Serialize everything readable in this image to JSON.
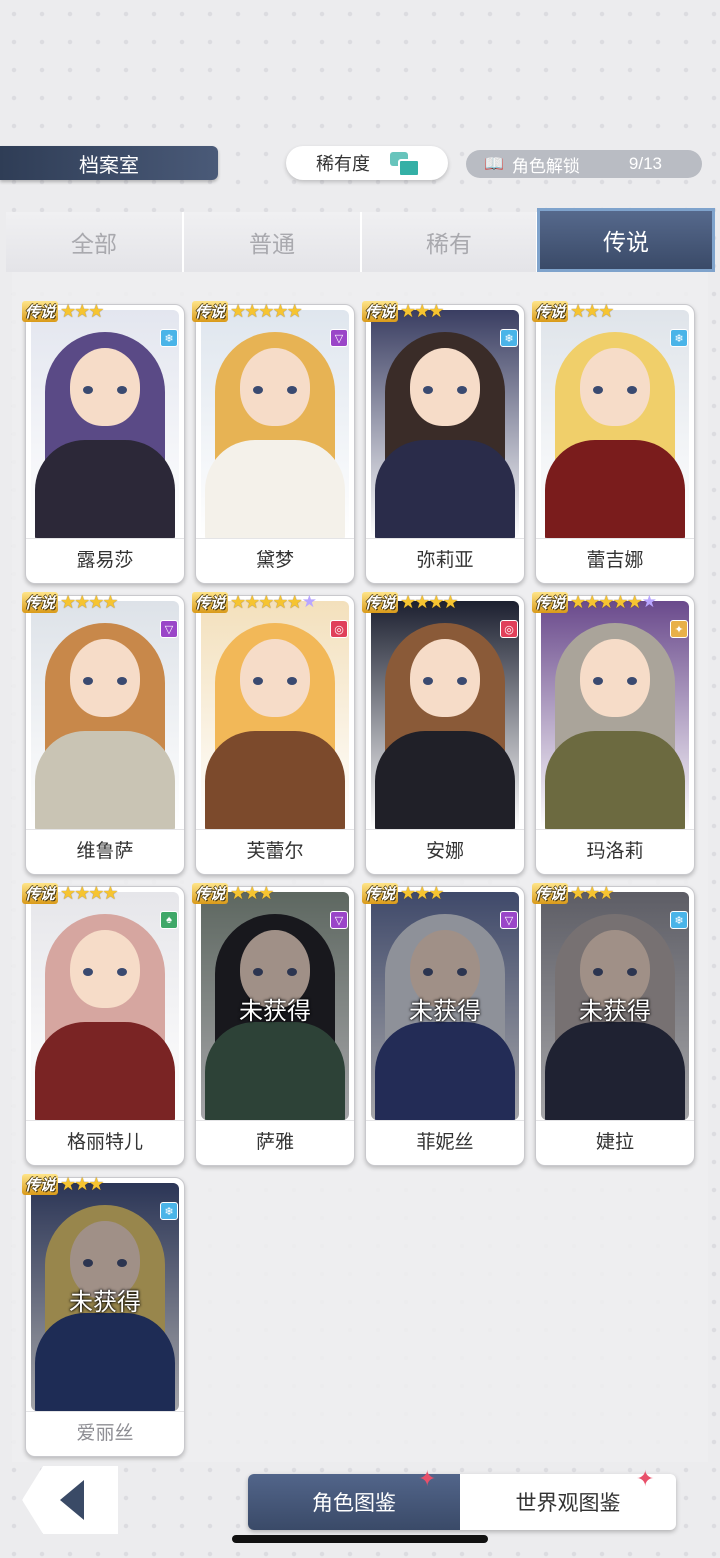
{
  "header": {
    "title": "档案室"
  },
  "rarity_button": {
    "label": "稀有度",
    "icon": "layers-icon",
    "accent": "#34b0a6"
  },
  "unlock": {
    "icon": "book-icon",
    "label": "角色解锁",
    "count": "9/13"
  },
  "tabs": [
    {
      "label": "全部",
      "active": false
    },
    {
      "label": "普通",
      "active": false
    },
    {
      "label": "稀有",
      "active": false
    },
    {
      "label": "传说",
      "active": true
    }
  ],
  "cards": [
    {
      "name": "露易莎",
      "rank": "传说",
      "stars": 3,
      "special": false,
      "element": "ice",
      "elementColor": "#4ab4e8",
      "locked": false,
      "hair": "#5a4a86",
      "body": "#2c2838",
      "bg": "#e3e6ef"
    },
    {
      "name": "黛梦",
      "rank": "传说",
      "stars": 5,
      "special": false,
      "element": "arcane",
      "elementColor": "#9a46c8",
      "locked": false,
      "hair": "#e7b354",
      "body": "#f4f1ea",
      "bg": "#dfe6ee"
    },
    {
      "name": "弥莉亚",
      "rank": "传说",
      "stars": 3,
      "special": false,
      "element": "ice",
      "elementColor": "#4ab4e8",
      "locked": false,
      "hair": "#3a2c28",
      "body": "#2a2c4a",
      "bg": "#3a3e62"
    },
    {
      "name": "蕾吉娜",
      "rank": "传说",
      "stars": 3,
      "special": false,
      "element": "ice",
      "elementColor": "#4ab4e8",
      "locked": false,
      "hair": "#f0cf6a",
      "body": "#7a1c1c",
      "bg": "#dfe4ea"
    },
    {
      "name": "维鲁萨",
      "rank": "传说",
      "stars": 4,
      "special": false,
      "element": "arcane",
      "elementColor": "#9a46c8",
      "locked": false,
      "hair": "#c8884a",
      "body": "#c9c4b4",
      "bg": "#dde2e8"
    },
    {
      "name": "芙蕾尔",
      "rank": "传说",
      "stars": 5,
      "special": true,
      "element": "fire",
      "elementColor": "#e0405a",
      "locked": false,
      "hair": "#f2b858",
      "body": "#7c4a2c",
      "bg": "#f3e0bc"
    },
    {
      "name": "安娜",
      "rank": "传说",
      "stars": 4,
      "special": false,
      "element": "fire",
      "elementColor": "#e0405a",
      "locked": false,
      "hair": "#8a5a38",
      "body": "#202028",
      "bg": "#1c2030"
    },
    {
      "name": "玛洛莉",
      "rank": "传说",
      "stars": 5,
      "special": true,
      "element": "light",
      "elementColor": "#e8b048",
      "locked": false,
      "hair": "#aaa49a",
      "body": "#6c6a40",
      "bg": "#6a4a8c"
    },
    {
      "name": "格丽特儿",
      "rank": "传说",
      "stars": 4,
      "special": false,
      "element": "nature",
      "elementColor": "#3fa868",
      "locked": false,
      "hair": "#d6a6a0",
      "body": "#7a2424",
      "bg": "#e6e6ea"
    },
    {
      "name": "萨雅",
      "rank": "传说",
      "stars": 3,
      "special": false,
      "element": "arcane",
      "elementColor": "#9a46c8",
      "locked": true,
      "lockedLabel": "未获得",
      "hair": "#1a1a1e",
      "body": "#3c5e48",
      "bg": "#8a9a8a"
    },
    {
      "name": "菲妮丝",
      "rank": "传说",
      "stars": 3,
      "special": false,
      "element": "arcane",
      "elementColor": "#9a46c8",
      "locked": true,
      "lockedLabel": "未获得",
      "hair": "#d8dde6",
      "body": "#2c3a7a",
      "bg": "#5a6a9a"
    },
    {
      "name": "婕拉",
      "rank": "传说",
      "stars": 3,
      "special": false,
      "element": "ice",
      "elementColor": "#4ab4e8",
      "locked": true,
      "lockedLabel": "未获得",
      "hair": "#b4aaa6",
      "body": "#262a40",
      "bg": "#8a8a92"
    },
    {
      "name": "爱丽丝",
      "rank": "传说",
      "stars": 3,
      "special": false,
      "element": "ice",
      "elementColor": "#4ab4e8",
      "locked": true,
      "lockedLabel": "未获得",
      "dimName": true,
      "hair": "#e8cc6a",
      "body": "#243a78",
      "bg": "#3a4a7a"
    }
  ],
  "bottom_nav": {
    "back_icon": "back-arrow-icon",
    "character_tab": "角色图鉴",
    "world_tab": "世界观图鉴",
    "spark_icon": "sparkle-icon",
    "spark_color": "#e8506a"
  }
}
